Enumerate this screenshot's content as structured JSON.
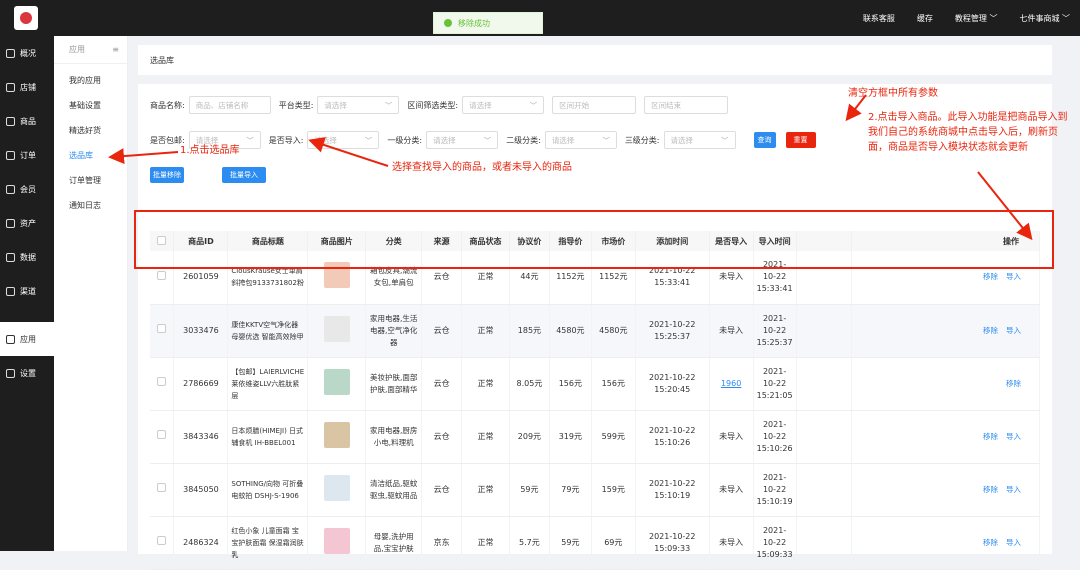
{
  "topbar": {
    "toast": "移除成功",
    "nav": [
      "联系客服",
      "缓存",
      "教程管理 ﹀",
      "七件事商城 ﹀"
    ]
  },
  "sidebar": [
    "概况",
    "店铺",
    "商品",
    "订单",
    "会员",
    "资产",
    "数据",
    "渠道",
    "应用",
    "设置"
  ],
  "subnav": {
    "header": "应用",
    "items": [
      "我的应用",
      "基础设置",
      "精选好货",
      "选品库",
      "订单管理",
      "通知日志"
    ]
  },
  "crumb": "选品库",
  "filters": {
    "row1": [
      {
        "label": "商品名称:",
        "placeholder": "商品、店铺名称"
      },
      {
        "label": "平台类型:",
        "placeholder": "请选择"
      },
      {
        "label": "区间筛选类型:",
        "placeholder": "请选择"
      },
      {
        "placeholder": "区间开始"
      },
      {
        "placeholder": "区间结束"
      }
    ],
    "row2": [
      {
        "label": "是否包邮:",
        "placeholder": "请选择"
      },
      {
        "label": "是否导入:",
        "placeholder": "请选择"
      },
      {
        "label": "一级分类:",
        "placeholder": "请选择"
      },
      {
        "label": "二级分类:",
        "placeholder": "请选择"
      },
      {
        "label": "三级分类:",
        "placeholder": "请选择"
      }
    ],
    "query": "查询",
    "reset": "重置",
    "batch_remove": "批量移除",
    "batch_import": "批量导入"
  },
  "table": {
    "headers": [
      "",
      "商品ID",
      "商品标题",
      "商品图片",
      "分类",
      "来源",
      "商品状态",
      "协议价",
      "指导价",
      "市场价",
      "添加时间",
      "是否导入",
      "导入时间",
      "",
      "操作"
    ],
    "rows": [
      {
        "id": "2601059",
        "title": "ClousKrause女士单肩斜挎包9133731802粉",
        "cat": "箱包皮具,潮流女包,单肩包",
        "src": "云仓",
        "status": "正常",
        "agree": "44元",
        "guide": "1152元",
        "market": "1152元",
        "added": "2021-10-22 15:33:41",
        "imported": "未导入",
        "import_time": "2021-10-22 15:33:41",
        "ops": [
          "移除",
          "导入"
        ],
        "color": "#f3c9b8"
      },
      {
        "id": "3033476",
        "title": "康佳KKTV空气净化器母婴优选 智能高效除甲",
        "cat": "家用电器,生活电器,空气净化器",
        "src": "云仓",
        "status": "正常",
        "agree": "185元",
        "guide": "4580元",
        "market": "4580元",
        "added": "2021-10-22 15:25:37",
        "imported": "未导入",
        "import_time": "2021-10-22 15:25:37",
        "ops": [
          "移除",
          "导入"
        ],
        "color": "#e8e8e8"
      },
      {
        "id": "2786669",
        "title": "【包邮】LAIERLVICHE莱依维姿LLV六胜肽紧层",
        "cat": "美妆护肤,面部护肤,面部精华",
        "src": "云仓",
        "status": "正常",
        "agree": "8.05元",
        "guide": "156元",
        "market": "156元",
        "added": "2021-10-22 15:20:45",
        "imported": "1960",
        "import_time": "2021-10-22 15:21:05",
        "ops": [
          "移除"
        ],
        "color": "#b9d8c8"
      },
      {
        "id": "3843346",
        "title": "日本烦膳(HIMEJI) 日式辅食机 IH-BBEL001",
        "cat": "家用电器,厨房小电,料理机",
        "src": "云仓",
        "status": "正常",
        "agree": "209元",
        "guide": "319元",
        "market": "599元",
        "added": "2021-10-22 15:10:26",
        "imported": "未导入",
        "import_time": "2021-10-22 15:10:26",
        "ops": [
          "移除",
          "导入"
        ],
        "color": "#d9c4a3"
      },
      {
        "id": "3845050",
        "title": "SOTHING/向物 可折叠电蚊拍 DSHJ-S-1906",
        "cat": "清洁纸品,驱蚊驱虫,驱蚊用品",
        "src": "云仓",
        "status": "正常",
        "agree": "59元",
        "guide": "79元",
        "market": "159元",
        "added": "2021-10-22 15:10:19",
        "imported": "未导入",
        "import_time": "2021-10-22 15:10:19",
        "ops": [
          "移除",
          "导入"
        ],
        "color": "#dde7ef"
      },
      {
        "id": "2486324",
        "title": "红色小象 儿童面霜 宝宝护肤面霜 保湿霜润肤乳",
        "cat": "母婴,洗护用品,宝宝护肤",
        "src": "京东",
        "status": "正常",
        "agree": "5.7元",
        "guide": "59元",
        "market": "69元",
        "added": "2021-10-22 15:09:33",
        "imported": "未导入",
        "import_time": "2021-10-22 15:09:33",
        "ops": [
          "移除",
          "导入"
        ],
        "color": "#f4c6d4"
      }
    ]
  },
  "annotations": {
    "a1": "1.点击选品库",
    "a2": "选择查找导入的商品，或者未导入的商品",
    "a3": "清空方框中所有参数",
    "a4": "2.点击导入商品。此导入功能是把商品导入到我们自己的系统商城中点击导入后，刷新页面，商品是否导入模块状态就会更新"
  }
}
